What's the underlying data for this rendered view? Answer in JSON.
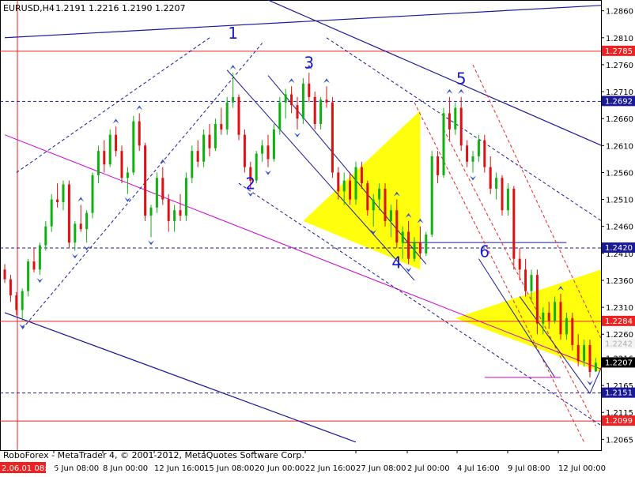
{
  "header": {
    "symbol": "EURUSD,H4",
    "ohlc": "1.2191 1.2216 1.2190 1.2207"
  },
  "footer": {
    "watermark": "RoboForex - MetaTrader 4, © 2001-2012, MetaQuotes Software Corp."
  },
  "colors": {
    "bull": "#11b011",
    "bear": "#dd1111",
    "support": "#ee2222",
    "trendline": "#1a1a99",
    "pitchfork": "#d000d0",
    "triangle": "#ffff00",
    "wave_label": "#1a1acc",
    "fractal": "#3050d0"
  },
  "chart_data": {
    "type": "candlestick",
    "instrument": "EURUSD",
    "timeframe": "H4",
    "ylim": [
      1.2045,
      1.288
    ],
    "x_ticks": [
      "5 Jun 08:00",
      "8 Jun 00:00",
      "12 Jun 16:00",
      "15 Jun 08:00",
      "20 Jun 00:00",
      "22 Jun 16:00",
      "27 Jun 08:00",
      "2 Jul 00:00",
      "4 Jul 16:00",
      "9 Jul 08:00",
      "12 Jul 00:00"
    ],
    "cursor_label": "2.06.01 08:00",
    "y_ticks": [
      1.286,
      1.281,
      1.276,
      1.271,
      1.266,
      1.261,
      1.256,
      1.251,
      1.246,
      1.241,
      1.236,
      1.231,
      1.226,
      1.2216,
      1.2165,
      1.2115,
      1.2065
    ],
    "horizontal_levels": [
      {
        "price": 1.2785,
        "label": "1.2785",
        "style": "solid"
      },
      {
        "price": 1.2692,
        "label": "1.2692",
        "style": "dashed"
      },
      {
        "price": 1.242,
        "label": "1.2420",
        "style": "dashed"
      },
      {
        "price": 1.2284,
        "label": "1.2284",
        "style": "solid"
      },
      {
        "price": 1.2151,
        "label": "1.2151",
        "style": "dashed"
      },
      {
        "price": 1.2099,
        "label": "1.2099",
        "style": "solid"
      }
    ],
    "current_price": {
      "price": 1.2207,
      "label": "1.2207"
    },
    "secondary_price": {
      "price": 1.2242,
      "label": "1.2242"
    },
    "wave_labels": [
      {
        "label": "1",
        "index": 39,
        "price": 1.2808
      },
      {
        "label": "2",
        "index": 42,
        "price": 1.2529
      },
      {
        "label": "3",
        "index": 52,
        "price": 1.2753
      },
      {
        "label": "4",
        "index": 67,
        "price": 1.2383
      },
      {
        "label": "5",
        "index": 78,
        "price": 1.2724
      },
      {
        "label": "6",
        "index": 82,
        "price": 1.2403
      }
    ],
    "candles": [
      [
        1.238,
        1.239,
        1.2355,
        1.2362
      ],
      [
        1.2362,
        1.237,
        1.232,
        1.2332
      ],
      [
        1.2332,
        1.2338,
        1.2295,
        1.2305
      ],
      [
        1.2305,
        1.2345,
        1.2285,
        1.234
      ],
      [
        1.234,
        1.24,
        1.233,
        1.2395
      ],
      [
        1.2395,
        1.242,
        1.2375,
        1.238
      ],
      [
        1.238,
        1.243,
        1.237,
        1.2425
      ],
      [
        1.2425,
        1.247,
        1.2415,
        1.246
      ],
      [
        1.246,
        1.252,
        1.245,
        1.251
      ],
      [
        1.251,
        1.254,
        1.2495,
        1.2505
      ],
      [
        1.2505,
        1.2545,
        1.249,
        1.2538
      ],
      [
        1.2538,
        1.2545,
        1.242,
        1.243
      ],
      [
        1.243,
        1.247,
        1.2415,
        1.2465
      ],
      [
        1.2465,
        1.25,
        1.245,
        1.2455
      ],
      [
        1.2455,
        1.249,
        1.243,
        1.2485
      ],
      [
        1.2485,
        1.256,
        1.2475,
        1.2555
      ],
      [
        1.2555,
        1.261,
        1.254,
        1.26
      ],
      [
        1.26,
        1.262,
        1.256,
        1.2575
      ],
      [
        1.2575,
        1.264,
        1.257,
        1.263
      ],
      [
        1.263,
        1.2645,
        1.259,
        1.26
      ],
      [
        1.26,
        1.261,
        1.254,
        1.255
      ],
      [
        1.255,
        1.257,
        1.252,
        1.256
      ],
      [
        1.256,
        1.2665,
        1.2555,
        1.2655
      ],
      [
        1.2655,
        1.267,
        1.26,
        1.261
      ],
      [
        1.261,
        1.2615,
        1.247,
        1.248
      ],
      [
        1.248,
        1.25,
        1.244,
        1.2495
      ],
      [
        1.2495,
        1.256,
        1.2485,
        1.255
      ],
      [
        1.255,
        1.257,
        1.25,
        1.251
      ],
      [
        1.251,
        1.252,
        1.245,
        1.247
      ],
      [
        1.247,
        1.25,
        1.245,
        1.249
      ],
      [
        1.249,
        1.252,
        1.247,
        1.248
      ],
      [
        1.248,
        1.256,
        1.247,
        1.255
      ],
      [
        1.255,
        1.261,
        1.254,
        1.26
      ],
      [
        1.26,
        1.262,
        1.257,
        1.258
      ],
      [
        1.258,
        1.264,
        1.257,
        1.263
      ],
      [
        1.263,
        1.265,
        1.259,
        1.2605
      ],
      [
        1.2605,
        1.266,
        1.26,
        1.265
      ],
      [
        1.265,
        1.268,
        1.263,
        1.264
      ],
      [
        1.264,
        1.27,
        1.263,
        1.269
      ],
      [
        1.269,
        1.2745,
        1.268,
        1.27
      ],
      [
        1.27,
        1.2705,
        1.262,
        1.263
      ],
      [
        1.263,
        1.264,
        1.256,
        1.257
      ],
      [
        1.257,
        1.258,
        1.253,
        1.2545
      ],
      [
        1.2545,
        1.26,
        1.254,
        1.2595
      ],
      [
        1.2595,
        1.262,
        1.258,
        1.261
      ],
      [
        1.261,
        1.263,
        1.257,
        1.2585
      ],
      [
        1.2585,
        1.265,
        1.258,
        1.264
      ],
      [
        1.264,
        1.27,
        1.263,
        1.269
      ],
      [
        1.269,
        1.2715,
        1.266,
        1.2705
      ],
      [
        1.2705,
        1.272,
        1.267,
        1.2685
      ],
      [
        1.2685,
        1.27,
        1.264,
        1.266
      ],
      [
        1.266,
        1.2735,
        1.265,
        1.2725
      ],
      [
        1.2725,
        1.2745,
        1.269,
        1.27
      ],
      [
        1.27,
        1.271,
        1.264,
        1.265
      ],
      [
        1.265,
        1.27,
        1.264,
        1.2695
      ],
      [
        1.2695,
        1.272,
        1.268,
        1.269
      ],
      [
        1.269,
        1.27,
        1.255,
        1.256
      ],
      [
        1.256,
        1.257,
        1.251,
        1.2525
      ],
      [
        1.2525,
        1.256,
        1.25,
        1.2545
      ],
      [
        1.2545,
        1.256,
        1.25,
        1.251
      ],
      [
        1.251,
        1.258,
        1.25,
        1.257
      ],
      [
        1.257,
        1.258,
        1.253,
        1.254
      ],
      [
        1.254,
        1.2545,
        1.248,
        1.249
      ],
      [
        1.249,
        1.252,
        1.246,
        1.251
      ],
      [
        1.251,
        1.254,
        1.249,
        1.253
      ],
      [
        1.253,
        1.254,
        1.246,
        1.247
      ],
      [
        1.247,
        1.25,
        1.244,
        1.249
      ],
      [
        1.249,
        1.251,
        1.242,
        1.243
      ],
      [
        1.243,
        1.246,
        1.24,
        1.245
      ],
      [
        1.245,
        1.247,
        1.239,
        1.24
      ],
      [
        1.24,
        1.244,
        1.2395,
        1.243
      ],
      [
        1.243,
        1.246,
        1.24,
        1.241
      ],
      [
        1.241,
        1.245,
        1.2405,
        1.2445
      ],
      [
        1.2445,
        1.26,
        1.244,
        1.259
      ],
      [
        1.259,
        1.26,
        1.254,
        1.2555
      ],
      [
        1.2555,
        1.268,
        1.255,
        1.267
      ],
      [
        1.267,
        1.27,
        1.262,
        1.264
      ],
      [
        1.264,
        1.269,
        1.263,
        1.268
      ],
      [
        1.268,
        1.27,
        1.26,
        1.261
      ],
      [
        1.261,
        1.262,
        1.257,
        1.258
      ],
      [
        1.258,
        1.26,
        1.256,
        1.259
      ],
      [
        1.259,
        1.263,
        1.258,
        1.262
      ],
      [
        1.262,
        1.263,
        1.256,
        1.257
      ],
      [
        1.257,
        1.259,
        1.252,
        1.253
      ],
      [
        1.253,
        1.256,
        1.251,
        1.255
      ],
      [
        1.255,
        1.2555,
        1.248,
        1.249
      ],
      [
        1.249,
        1.254,
        1.248,
        1.253
      ],
      [
        1.253,
        1.2535,
        1.238,
        1.24
      ],
      [
        1.24,
        1.242,
        1.236,
        1.238
      ],
      [
        1.238,
        1.24,
        1.233,
        1.234
      ],
      [
        1.234,
        1.238,
        1.232,
        1.237
      ],
      [
        1.237,
        1.238,
        1.226,
        1.228
      ],
      [
        1.228,
        1.231,
        1.226,
        1.23
      ],
      [
        1.23,
        1.232,
        1.227,
        1.2285
      ],
      [
        1.2285,
        1.233,
        1.228,
        1.232
      ],
      [
        1.232,
        1.2335,
        1.225,
        1.226
      ],
      [
        1.226,
        1.23,
        1.225,
        1.229
      ],
      [
        1.229,
        1.23,
        1.223,
        1.224
      ],
      [
        1.224,
        1.226,
        1.22,
        1.221
      ],
      [
        1.221,
        1.225,
        1.22,
        1.224
      ],
      [
        1.224,
        1.225,
        1.218,
        1.219
      ],
      [
        1.2191,
        1.2216,
        1.219,
        1.2207
      ]
    ]
  }
}
